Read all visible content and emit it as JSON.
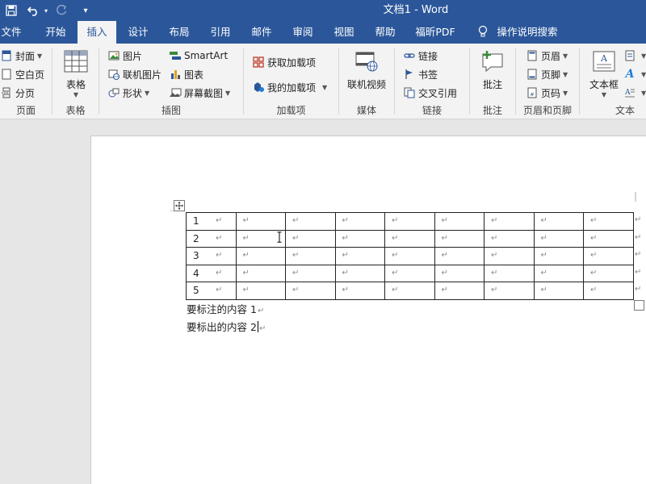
{
  "app": {
    "title": "文档1  -  Word"
  },
  "quick_access": {
    "save_icon": "save-icon",
    "undo_icon": "undo-icon",
    "redo_icon": "redo-icon",
    "customize_icon": "customize-icon"
  },
  "tabs": [
    {
      "label": "文件"
    },
    {
      "label": "开始"
    },
    {
      "label": "插入",
      "active": true
    },
    {
      "label": "设计"
    },
    {
      "label": "布局"
    },
    {
      "label": "引用"
    },
    {
      "label": "邮件"
    },
    {
      "label": "审阅"
    },
    {
      "label": "视图"
    },
    {
      "label": "帮助"
    },
    {
      "label": "福昕PDF"
    },
    {
      "label": "操作说明搜索"
    }
  ],
  "ribbon": {
    "pages": {
      "label": "页面",
      "cover": "封面",
      "blank_page": "空白页",
      "page_break": "分页"
    },
    "tables": {
      "label": "表格",
      "table": "表格"
    },
    "illustrations": {
      "label": "插图",
      "picture": "图片",
      "online_picture": "联机图片",
      "shapes": "形状",
      "smartart": "SmartArt",
      "chart": "图表",
      "screenshot": "屏幕截图"
    },
    "addins": {
      "label": "加载项",
      "get_addins": "获取加载项",
      "my_addins": "我的加载项"
    },
    "media": {
      "label": "媒体",
      "online_video": "联机视频"
    },
    "links": {
      "label": "链接",
      "link": "链接",
      "bookmark": "书签",
      "cross_reference": "交叉引用"
    },
    "comments": {
      "label": "批注",
      "comment": "批注"
    },
    "header_footer": {
      "label": "页眉和页脚",
      "header": "页眉",
      "footer": "页脚",
      "page_number": "页码"
    },
    "text": {
      "label": "文本",
      "text_box": "文本框"
    }
  },
  "document": {
    "table": {
      "rows": [
        {
          "label": "1"
        },
        {
          "label": "2"
        },
        {
          "label": "3"
        },
        {
          "label": "4"
        },
        {
          "label": "5"
        }
      ],
      "columns": 9
    },
    "paragraphs": [
      {
        "text": "要标注的内容 1"
      },
      {
        "text": "要标出的内容 2"
      }
    ],
    "paragraph_mark": "↵"
  },
  "colors": {
    "brand": "#2b579a",
    "ribbon_bg": "#f3f3f3",
    "canvas_bg": "#e6e6e6"
  }
}
